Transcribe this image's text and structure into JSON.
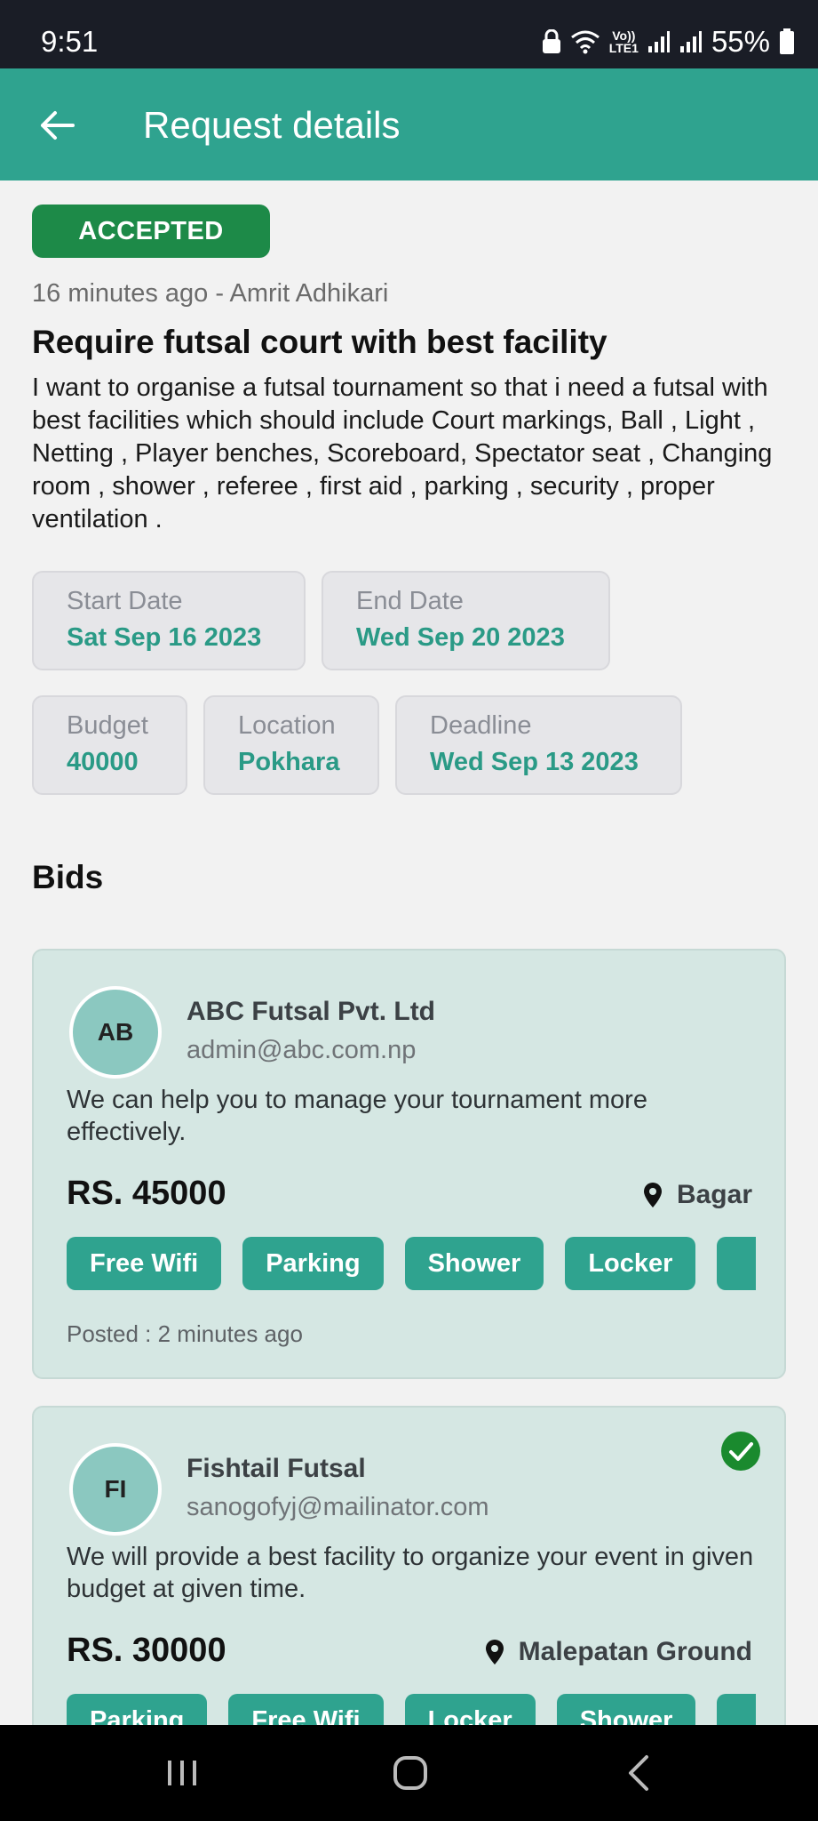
{
  "status_bar": {
    "time": "9:51",
    "network_label_top": "Vo))",
    "network_label_bottom": "LTE1",
    "battery": "55%"
  },
  "app_bar": {
    "title": "Request details"
  },
  "request": {
    "status_badge": "ACCEPTED",
    "meta": "16 minutes ago - Amrit Adhikari",
    "title": "Require futsal court with best facility",
    "description": "I want to organise a futsal tournament so that i need a futsal with best facilities which should include Court markings, Ball , Light , Netting , Player benches, Scoreboard,  Spectator seat , Changing room , shower , referee , first aid , parking , security , proper ventilation .",
    "start_date": {
      "label": "Start Date",
      "value": "Sat Sep 16 2023"
    },
    "end_date": {
      "label": "End Date",
      "value": "Wed Sep 20 2023"
    },
    "budget": {
      "label": "Budget",
      "value": "40000"
    },
    "location": {
      "label": "Location",
      "value": "Pokhara"
    },
    "deadline": {
      "label": "Deadline",
      "value": "Wed Sep 13 2023"
    }
  },
  "bids": {
    "heading": "Bids",
    "items": [
      {
        "initials": "AB",
        "name": "ABC Futsal Pvt. Ltd",
        "email": "admin@abc.com.np",
        "message": "We can help you to manage your tournament more effectively.",
        "price": "RS. 45000",
        "location": "Bagar",
        "facilities": [
          "Free Wifi",
          "Parking",
          "Shower",
          "Locker"
        ],
        "posted": "Posted : 2 minutes ago",
        "accepted": false
      },
      {
        "initials": "FI",
        "name": "Fishtail Futsal",
        "email": "sanogofyj@mailinator.com",
        "message": "We will provide a best facility to organize your event in given budget at given time.",
        "price": "RS. 30000",
        "location": "Malepatan Ground",
        "facilities": [
          "Parking",
          "Free Wifi",
          "Locker",
          "Shower"
        ],
        "accepted": true
      }
    ]
  },
  "icons": {
    "back": "arrow-left-icon",
    "location": "map-pin-icon",
    "accepted": "check-circle-icon",
    "nav_recents": "recents-icon",
    "nav_home": "home-icon",
    "nav_back": "chevron-left-icon"
  },
  "colors": {
    "primary": "#2fa38f",
    "accepted_badge": "#1d8a48",
    "card_bg": "#d5e7e3",
    "check": "#1a8a2e"
  }
}
